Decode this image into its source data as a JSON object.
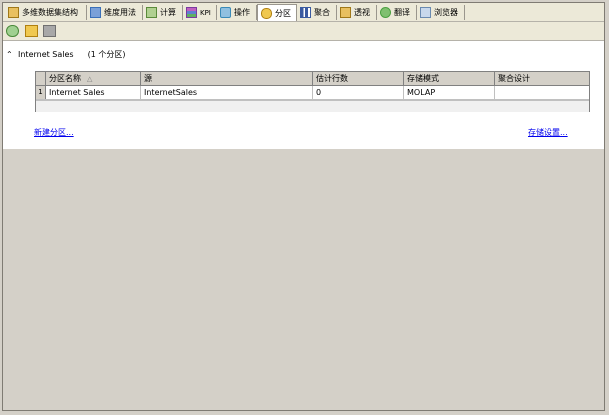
{
  "tabs": [
    {
      "label": "多维数据集结构",
      "icon": "cube-structure-icon",
      "color": "#c8901a"
    },
    {
      "label": "维度用法",
      "icon": "dimension-usage-icon",
      "color": "#3a6fb8"
    },
    {
      "label": "计算",
      "icon": "calculations-icon",
      "color": "#5a8a3a"
    },
    {
      "label": "KPI",
      "icon": "kpi-icon",
      "color": "#7a3aa0"
    },
    {
      "label": "操作",
      "icon": "actions-icon",
      "color": "#3a8ab8"
    },
    {
      "label": "分区",
      "icon": "partitions-icon",
      "color": "#e0a020",
      "active": true
    },
    {
      "label": "聚合",
      "icon": "aggregations-icon",
      "color": "#3a5aa0"
    },
    {
      "label": "透视",
      "icon": "perspectives-icon",
      "color": "#c8901a"
    },
    {
      "label": "翻译",
      "icon": "translations-icon",
      "color": "#4aa040"
    },
    {
      "label": "浏览器",
      "icon": "browser-icon",
      "color": "#6a8ab0"
    }
  ],
  "toolbar": {
    "buttons": [
      "process-icon",
      "new-partition-icon",
      "storage-settings-icon"
    ]
  },
  "group": {
    "title": "Internet Sales",
    "count": "(1 个分区)"
  },
  "grid": {
    "columns": [
      "分区名称",
      "源",
      "估计行数",
      "存储模式",
      "聚合设计"
    ],
    "sort_indicator": "△",
    "rows": [
      {
        "num": "1",
        "cells": [
          "Internet Sales",
          "InternetSales",
          "0",
          "MOLAP",
          ""
        ]
      }
    ]
  },
  "links": {
    "new_partition": "新建分区...",
    "storage_settings": "存储设置..."
  }
}
